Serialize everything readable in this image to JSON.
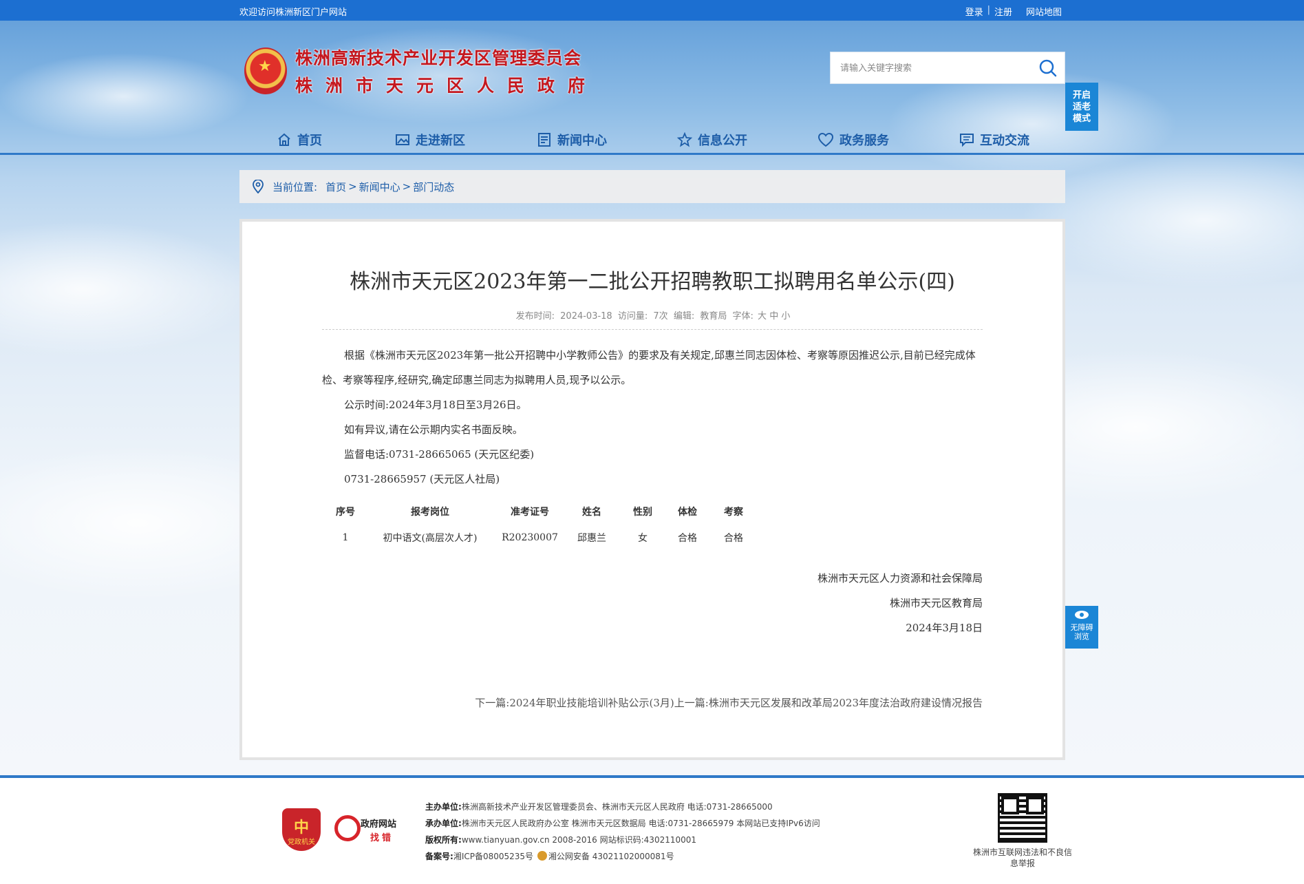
{
  "topbar": {
    "welcome": "欢迎访问株洲新区门户网站",
    "login": "登录",
    "sep": "|",
    "register": "注册",
    "sitemap": "网站地图"
  },
  "header": {
    "org_line1": "株洲高新技术产业开发区管理委员会",
    "org_line2": "株洲市天元区人民政府",
    "search_placeholder": "请输入关键字搜索",
    "elder_mode": "开启适老模式"
  },
  "nav": [
    {
      "label": "首页",
      "icon": "home-icon"
    },
    {
      "label": "走进新区",
      "icon": "picture-icon"
    },
    {
      "label": "新闻中心",
      "icon": "news-icon"
    },
    {
      "label": "信息公开",
      "icon": "star-icon"
    },
    {
      "label": "政务服务",
      "icon": "heart-icon"
    },
    {
      "label": "互动交流",
      "icon": "chat-icon"
    }
  ],
  "breadcrumb": {
    "label": "当前位置:",
    "path": [
      "首页",
      "新闻中心",
      "部门动态"
    ],
    "sep": ">"
  },
  "article": {
    "title": "株洲市天元区2023年第一二批公开招聘教职工拟聘用名单公示(四)",
    "meta": {
      "publish_label": "发布时间:",
      "publish_date": "2024-03-18",
      "views_label": "访问量:",
      "views": "7次",
      "editor_label": "编辑:",
      "editor": "教育局",
      "font_label": "字体:",
      "font_sizes": [
        "大",
        "中",
        "小"
      ]
    },
    "paragraphs": [
      "根据《株洲市天元区2023年第一批公开招聘中小学教师公告》的要求及有关规定,邱惠兰同志因体检、考察等原因推迟公示,目前已经完成体检、考察等程序,经研究,确定邱惠兰同志为拟聘用人员,现予以公示。",
      "公示时间:2024年3月18日至3月26日。",
      "如有异议,请在公示期内实名书面反映。",
      "监督电话:0731-28665065 (天元区纪委)",
      "0731-28665957 (天元区人社局)"
    ],
    "table": {
      "headers": [
        "序号",
        "报考岗位",
        "准考证号",
        "姓名",
        "性别",
        "体检",
        "考察"
      ],
      "rows": [
        [
          "1",
          "初中语文(高层次人才)",
          "R20230007",
          "邱惠兰",
          "女",
          "合格",
          "合格"
        ]
      ]
    },
    "signature": [
      "株洲市天元区人力资源和社会保障局",
      "株洲市天元区教育局",
      "2024年3月18日"
    ],
    "next": "下一篇:2024年职业技能培训补贴公示(3月)",
    "prev": "上一篇:株洲市天元区发展和改革局2023年度法治政府建设情况报告"
  },
  "accessibility": "无障碍浏览",
  "footer": {
    "badge1_text": "党政机关",
    "badge2_line1": "政府网站",
    "badge2_line2": "找错",
    "host_label": "主办单位:",
    "host": "株洲高新技术产业开发区管理委员会、株洲市天元区人民政府 电话:0731-28665000",
    "undertake_label": "承办单位:",
    "undertake": "株洲市天元区人民政府办公室 株洲市天元区数据局 电话:0731-28665979 本网站已支持IPv6访问",
    "copyright_label": "版权所有:",
    "copyright": "www.tianyuan.gov.cn 2008-2016 网站标识码:4302110001",
    "icp_label": "备案号:",
    "icp": "湘ICP备08005235号",
    "police": "湘公网安备 43021102000081号",
    "qr_caption": "株洲市互联网违法和不良信息举报"
  },
  "colors": {
    "topbar": "#1c6fd1",
    "nav_text": "#1d5da8",
    "logo_red": "#c4181f",
    "side_button": "#1b86d6"
  }
}
